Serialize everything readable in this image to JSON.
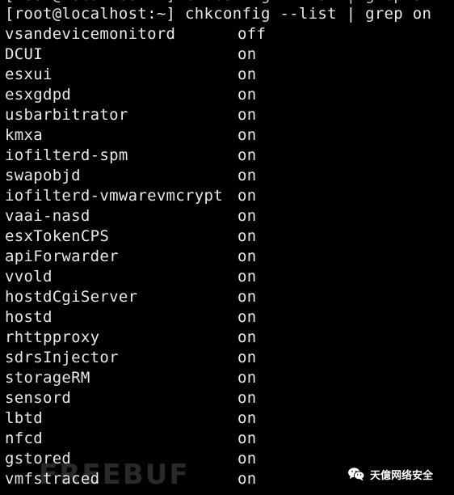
{
  "terminal": {
    "prev_line": "[root@localhost:~] chkconfig --list | grep on",
    "prompt": "[root@localhost:~] chkconfig --list | grep on",
    "services": [
      {
        "name": "vsandevicemonitord",
        "state": "off"
      },
      {
        "name": "DCUI",
        "state": "on"
      },
      {
        "name": "esxui",
        "state": "on"
      },
      {
        "name": "esxgdpd",
        "state": "on"
      },
      {
        "name": "usbarbitrator",
        "state": "on"
      },
      {
        "name": "kmxa",
        "state": "on"
      },
      {
        "name": "iofilterd-spm",
        "state": "on"
      },
      {
        "name": "swapobjd",
        "state": "on"
      },
      {
        "name": "iofilterd-vmwarevmcrypt",
        "state": "on"
      },
      {
        "name": "vaai-nasd",
        "state": "on"
      },
      {
        "name": "esxTokenCPS",
        "state": "on"
      },
      {
        "name": "apiForwarder",
        "state": "on"
      },
      {
        "name": "vvold",
        "state": "on"
      },
      {
        "name": "hostdCgiServer",
        "state": "on"
      },
      {
        "name": "hostd",
        "state": "on"
      },
      {
        "name": "rhttpproxy",
        "state": "on"
      },
      {
        "name": "sdrsInjector",
        "state": "on"
      },
      {
        "name": "storageRM",
        "state": "on"
      },
      {
        "name": "sensord",
        "state": "on"
      },
      {
        "name": "lbtd",
        "state": "on"
      },
      {
        "name": "nfcd",
        "state": "on"
      },
      {
        "name": "gstored",
        "state": "on"
      },
      {
        "name": "vmfstraced",
        "state": "on"
      }
    ]
  },
  "watermark": {
    "text": "FREEBUF"
  },
  "badge": {
    "icon": "wechat-icon",
    "text": "天億网络安全"
  },
  "colors": {
    "background": "#000000",
    "text": "#e8e8e8"
  }
}
